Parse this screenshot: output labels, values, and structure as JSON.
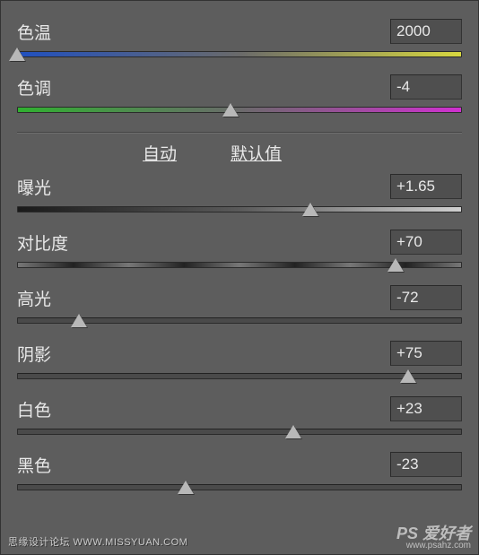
{
  "wb": {
    "temperature": {
      "label": "色温",
      "value": "2000",
      "thumb_pct": 0
    },
    "tint": {
      "label": "色调",
      "value": "-4",
      "thumb_pct": 48
    }
  },
  "links": {
    "auto": "自动",
    "default": "默认值"
  },
  "tone": {
    "exposure": {
      "label": "曝光",
      "value": "+1.65",
      "thumb_pct": 66
    },
    "contrast": {
      "label": "对比度",
      "value": "+70",
      "thumb_pct": 85
    },
    "highlights": {
      "label": "高光",
      "value": "-72",
      "thumb_pct": 14
    },
    "shadows": {
      "label": "阴影",
      "value": "+75",
      "thumb_pct": 88
    },
    "whites": {
      "label": "白色",
      "value": "+23",
      "thumb_pct": 62
    },
    "blacks": {
      "label": "黑色",
      "value": "-23",
      "thumb_pct": 38
    }
  },
  "watermarks": {
    "left": "思缘设计论坛  WWW.MISSYUAN.COM",
    "right": "PS 爱好者",
    "right_sub": "www.psahz.com"
  }
}
